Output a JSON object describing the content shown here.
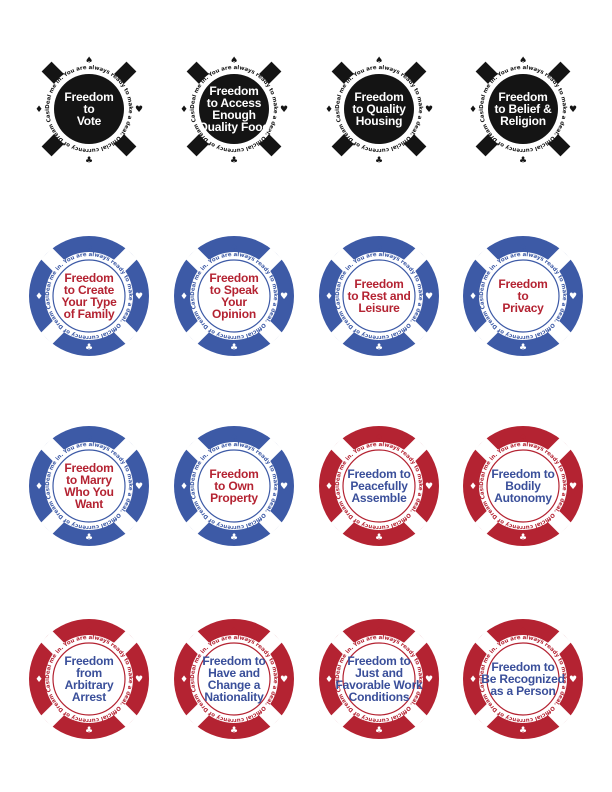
{
  "rim_text": "Deal me in. You are always ready to make a deal. Official currency of Dream Casino. Cannot be exchanged for cash.",
  "colors": {
    "black": "#141414",
    "blue": "#3d5aa6",
    "red": "#b42332",
    "white": "#ffffff",
    "label_red": "#b42332",
    "label_blue": "#3a4f9a"
  },
  "chips": [
    {
      "style": "black",
      "label": "Freedom to Vote",
      "lines": [
        "Freedom",
        "to",
        "Vote"
      ]
    },
    {
      "style": "black",
      "label": "Freedom to Access Enough Quality Food",
      "lines": [
        "Freedom",
        "to Access",
        "Enough",
        "Quality Food"
      ]
    },
    {
      "style": "black",
      "label": "Freedom to Quality Housing",
      "lines": [
        "Freedom",
        "to Quality",
        "Housing"
      ]
    },
    {
      "style": "black",
      "label": "Freedom to Belief & Religion",
      "lines": [
        "Freedom",
        "to Belief &",
        "Religion"
      ]
    },
    {
      "style": "blue",
      "label": "Freedom to Create Your Type of Family",
      "lines": [
        "Freedom",
        "to Create",
        "Your Type",
        "of Family"
      ]
    },
    {
      "style": "blue",
      "label": "Freedom to Speak Your Opinion",
      "lines": [
        "Freedom",
        "to Speak",
        "Your",
        "Opinion"
      ]
    },
    {
      "style": "blue",
      "label": "Freedom to Rest and Leisure",
      "lines": [
        "Freedom",
        "to Rest and",
        "Leisure"
      ]
    },
    {
      "style": "blue",
      "label": "Freedom to Privacy",
      "lines": [
        "Freedom",
        "to",
        "Privacy"
      ]
    },
    {
      "style": "blue",
      "label": "Freedom to Marry Who You Want",
      "lines": [
        "Freedom",
        "to Marry",
        "Who You",
        "Want"
      ]
    },
    {
      "style": "blue",
      "label": "Freedom to Own Property",
      "lines": [
        "Freedom",
        "to Own",
        "Property"
      ]
    },
    {
      "style": "red",
      "label": "Freedom to Peacefully Assemble",
      "lines": [
        "Freedom to",
        "Peacefully",
        "Assemble"
      ]
    },
    {
      "style": "red",
      "label": "Freedom to Bodily Autonomy",
      "lines": [
        "Freedom to",
        "Bodily",
        "Autonomy"
      ]
    },
    {
      "style": "red",
      "label": "Freedom from Arbitrary Arrest",
      "lines": [
        "Freedom",
        "from",
        "Arbitrary",
        "Arrest"
      ]
    },
    {
      "style": "red",
      "label": "Freedom to Have and Change a Nationality",
      "lines": [
        "Freedom to",
        "Have and",
        "Change a",
        "Nationality"
      ]
    },
    {
      "style": "red",
      "label": "Freedom to Just and Favorable Work Conditions",
      "lines": [
        "Freedom to",
        "Just and",
        "Favorable Work",
        "Conditions"
      ]
    },
    {
      "style": "red",
      "label": "Freedom to Be Recognized as a Person",
      "lines": [
        "Freedom to",
        "Be Recognized",
        "as a Person"
      ]
    }
  ]
}
